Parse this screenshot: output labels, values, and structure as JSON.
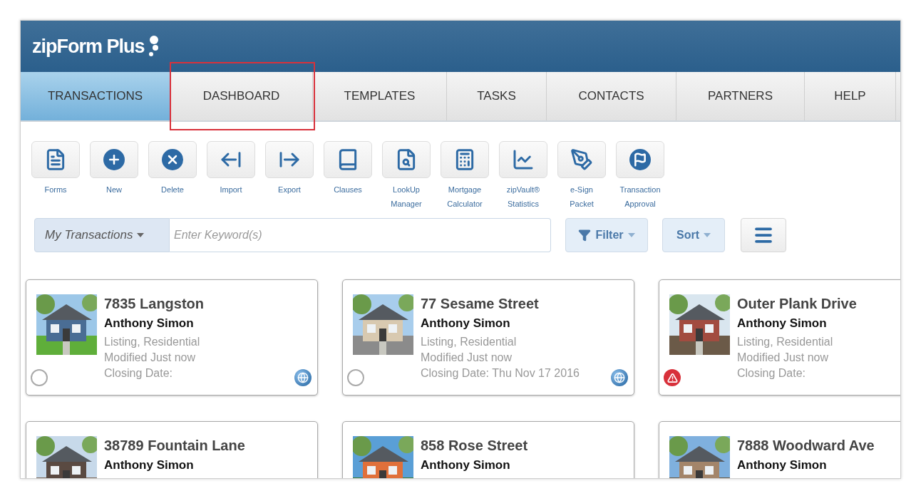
{
  "header": {
    "logo": "zipForm Plus"
  },
  "nav": [
    {
      "label": "TRANSACTIONS",
      "selected": true,
      "highlighted": false
    },
    {
      "label": "DASHBOARD",
      "selected": false,
      "highlighted": true
    },
    {
      "label": "TEMPLATES",
      "selected": false,
      "highlighted": false
    },
    {
      "label": "TASKS",
      "selected": false,
      "highlighted": false
    },
    {
      "label": "CONTACTS",
      "selected": false,
      "highlighted": false
    },
    {
      "label": "PARTNERS",
      "selected": false,
      "highlighted": false
    },
    {
      "label": "HELP",
      "selected": false,
      "highlighted": false
    }
  ],
  "toolbar": [
    {
      "kind": "forms",
      "label": [
        "Forms"
      ]
    },
    {
      "kind": "new",
      "label": [
        "New"
      ]
    },
    {
      "kind": "delete",
      "label": [
        "Delete"
      ]
    },
    {
      "kind": "import",
      "label": [
        "Import"
      ]
    },
    {
      "kind": "export",
      "label": [
        "Export"
      ]
    },
    {
      "kind": "clauses",
      "label": [
        "Clauses"
      ]
    },
    {
      "kind": "lookup",
      "label": [
        "LookUp",
        "Manager"
      ]
    },
    {
      "kind": "calculator",
      "label": [
        "Mortgage",
        "Calculator"
      ]
    },
    {
      "kind": "statistics",
      "label": [
        "zipVault®",
        "Statistics"
      ]
    },
    {
      "kind": "esign",
      "label": [
        "e-Sign",
        "Packet"
      ]
    },
    {
      "kind": "approval",
      "label": [
        "Transaction",
        "Approval"
      ]
    }
  ],
  "search": {
    "scope": "My Transactions",
    "placeholder": "Enter Keyword(s)",
    "filter": "Filter",
    "sort": "Sort"
  },
  "cards": [
    {
      "title": "7835 Langston",
      "agent": "Anthony Simon",
      "type": "Listing, Residential",
      "modified": "Modified Just now",
      "closing": "Closing Date:",
      "alert": false,
      "synced": true
    },
    {
      "title": "77 Sesame Street",
      "agent": "Anthony Simon",
      "type": "Listing, Residential",
      "modified": "Modified Just now",
      "closing": "Closing Date: Thu Nov 17 2016",
      "alert": false,
      "synced": true
    },
    {
      "title": "Outer Plank Drive",
      "agent": "Anthony Simon",
      "type": "Listing, Residential",
      "modified": "Modified Just now",
      "closing": "Closing Date:",
      "alert": true,
      "synced": false
    },
    {
      "title": "38789 Fountain Lane",
      "agent": "Anthony Simon"
    },
    {
      "title": "858 Rose Street",
      "agent": "Anthony Simon"
    },
    {
      "title": "7888 Woodward Ave",
      "agent": "Anthony Simon"
    }
  ]
}
